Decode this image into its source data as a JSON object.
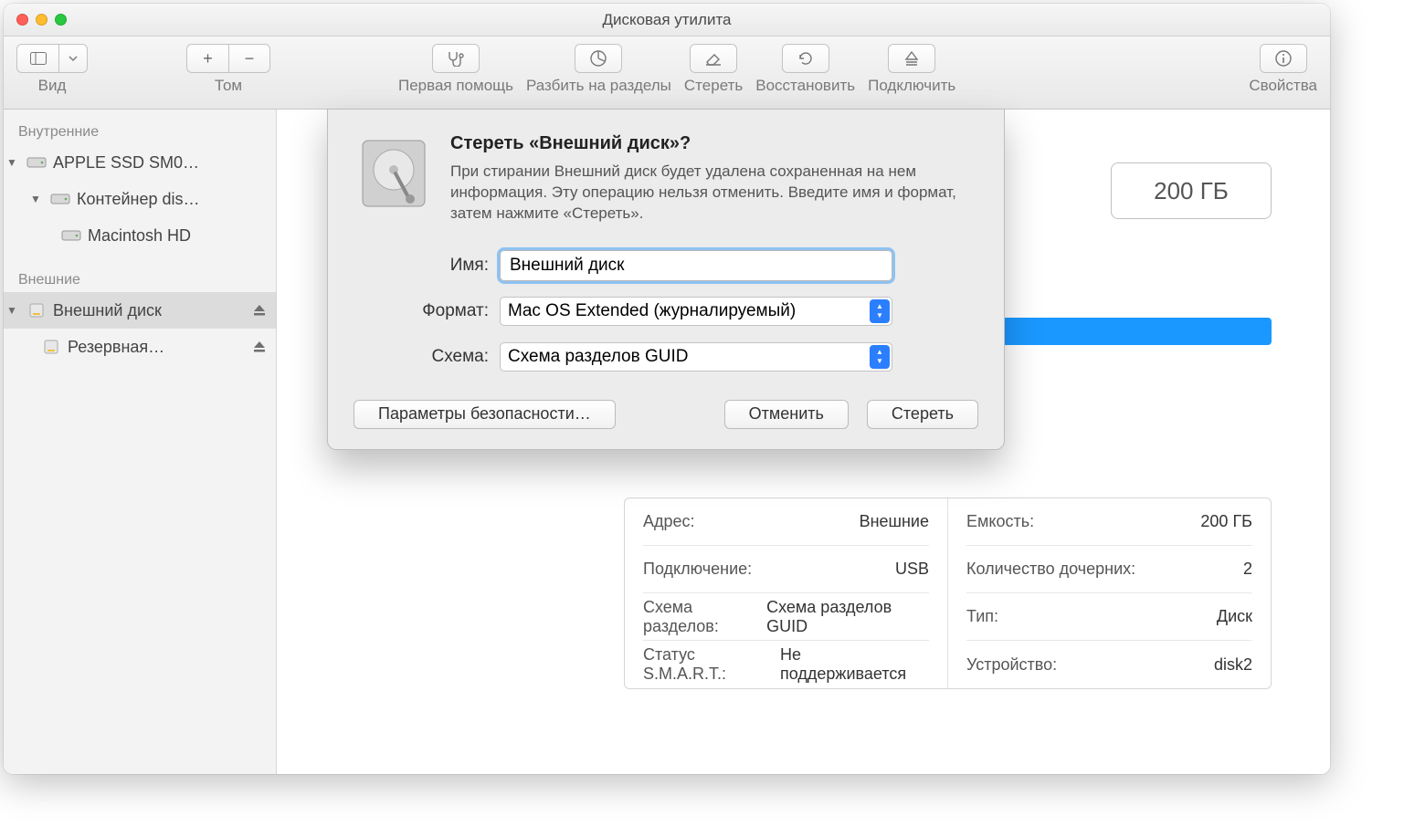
{
  "window": {
    "title": "Дисковая утилита"
  },
  "toolbar": {
    "view": "Вид",
    "volume": "Том",
    "first_aid": "Первая помощь",
    "partition": "Разбить на разделы",
    "erase": "Стереть",
    "restore": "Восстановить",
    "mount": "Подключить",
    "info": "Свойства"
  },
  "sidebar": {
    "internal_header": "Внутренние",
    "external_header": "Внешние",
    "internal": [
      {
        "label": "APPLE SSD SM0…",
        "level": 0,
        "expanded": true,
        "type": "disk"
      },
      {
        "label": "Контейнер dis…",
        "level": 1,
        "expanded": true,
        "type": "container"
      },
      {
        "label": "Macintosh HD",
        "level": 2,
        "expanded": false,
        "type": "volume"
      }
    ],
    "external": [
      {
        "label": "Внешний диск",
        "level": 0,
        "expanded": true,
        "selected": true,
        "type": "extdisk",
        "eject": true
      },
      {
        "label": "Резервная…",
        "level": 1,
        "expanded": false,
        "type": "extvol",
        "eject": true
      }
    ]
  },
  "content": {
    "size_badge": "200 ГБ"
  },
  "sheet": {
    "title": "Стереть «Внешний диск»?",
    "body": "При стирании Внешний диск будет удалена сохраненная на нем информация. Эту операцию нельзя отменить. Введите имя и формат, затем нажмите «Стереть».",
    "name_label": "Имя:",
    "name_value": "Внешний диск",
    "format_label": "Формат:",
    "format_value": "Mac OS Extended (журналируемый)",
    "scheme_label": "Схема:",
    "scheme_value": "Схема разделов GUID",
    "security_btn": "Параметры безопасности…",
    "cancel_btn": "Отменить",
    "erase_btn": "Стереть"
  },
  "info": {
    "left": [
      {
        "k": "Адрес:",
        "v": "Внешние"
      },
      {
        "k": "Подключение:",
        "v": "USB"
      },
      {
        "k": "Схема разделов:",
        "v": "Схема разделов GUID"
      },
      {
        "k": "Статус S.M.A.R.T.:",
        "v": "Не поддерживается"
      }
    ],
    "right": [
      {
        "k": "Емкость:",
        "v": "200 ГБ"
      },
      {
        "k": "Количество дочерних:",
        "v": "2"
      },
      {
        "k": "Тип:",
        "v": "Диск"
      },
      {
        "k": "Устройство:",
        "v": "disk2"
      }
    ]
  }
}
